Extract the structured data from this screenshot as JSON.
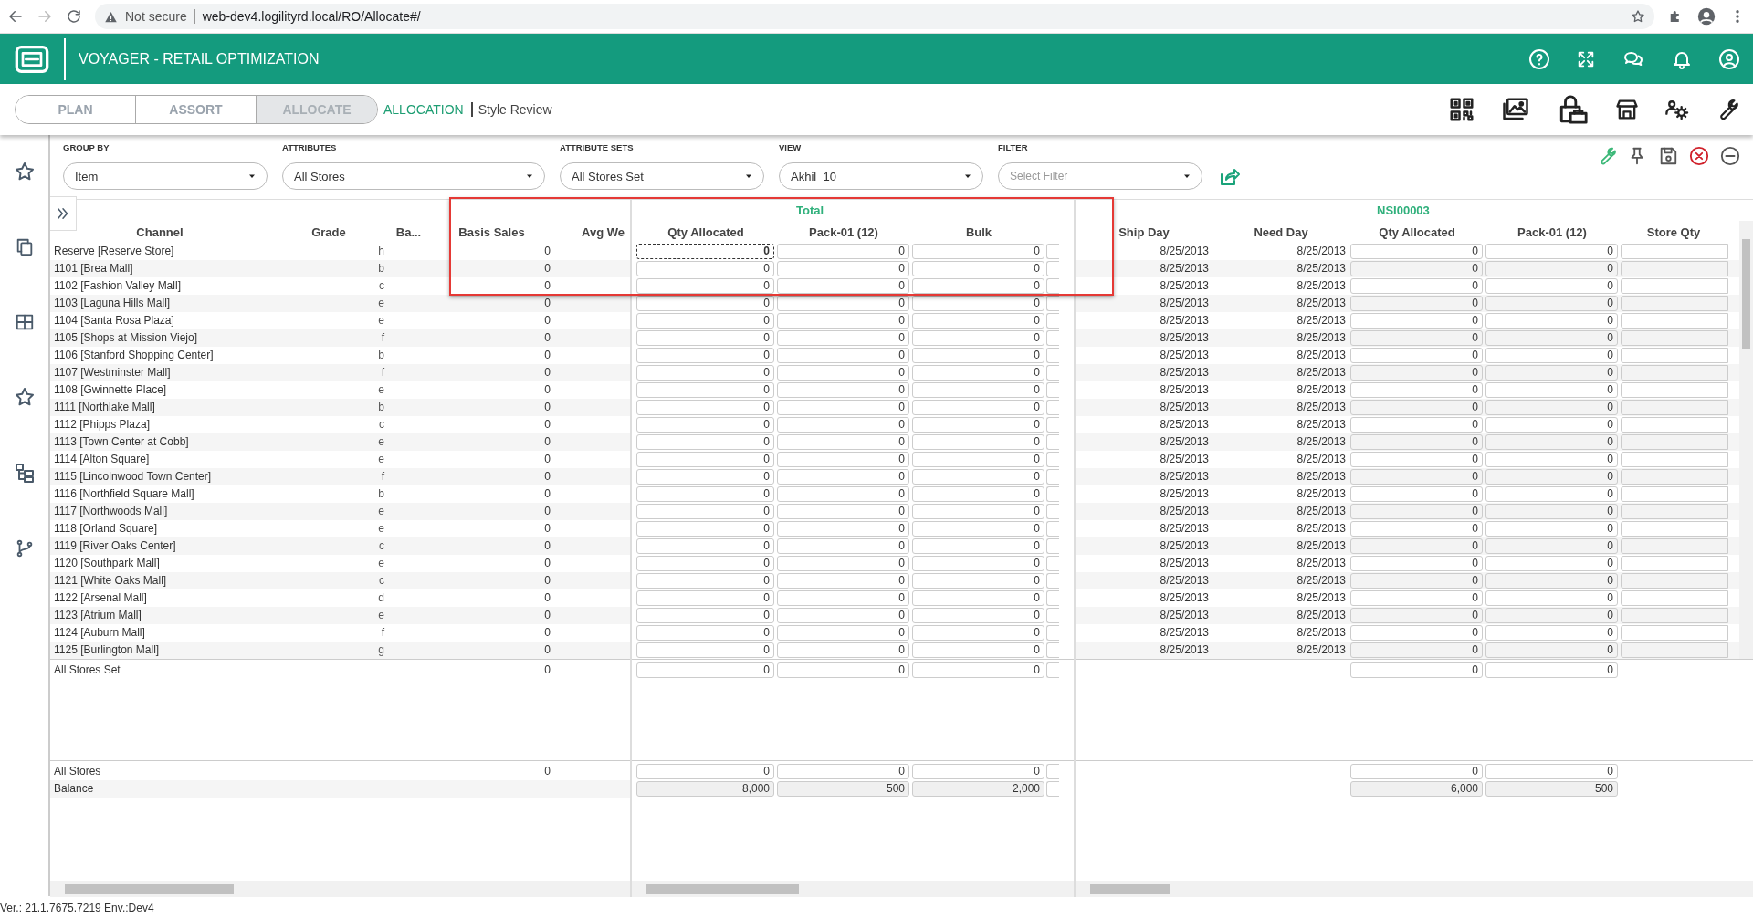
{
  "browser": {
    "security": "Not secure",
    "url": "web-dev4.logilityrd.local/RO/Allocate#/"
  },
  "app": {
    "title": "VOYAGER - RETAIL OPTIMIZATION"
  },
  "modules": [
    {
      "label": "PLAN",
      "selected": false
    },
    {
      "label": "ASSORT",
      "selected": false
    },
    {
      "label": "ALLOCATE",
      "selected": true
    }
  ],
  "breadcrumb": [
    {
      "label": "ALLOCATION",
      "kind": "link"
    },
    {
      "label": "Style Review",
      "kind": "current"
    }
  ],
  "filters": [
    {
      "label": "GROUP BY",
      "value": "Item"
    },
    {
      "label": "ATTRIBUTES",
      "value": "All Stores"
    },
    {
      "label": "ATTRIBUTE SETS",
      "value": "All Stores Set"
    },
    {
      "label": "VIEW",
      "value": "Akhil_10"
    },
    {
      "label": "FILTER",
      "placeholder": "Select Filter"
    }
  ],
  "grid": {
    "total_header": "Total",
    "nsi_header": "NSI00003",
    "left_columns": [
      "Channel",
      "Grade",
      "Ba...",
      "Basis Sales",
      "Avg We"
    ],
    "total_columns": [
      "Qty Allocated",
      "Pack-01 (12)",
      "Bulk"
    ],
    "right_columns": [
      "Ship Day",
      "Need Day",
      "Qty Allocated",
      "Pack-01 (12)",
      "Store Qty"
    ],
    "rows": [
      {
        "channel": "Reserve [Reserve Store]",
        "grade": "h",
        "basis_sales": "0",
        "total": [
          "0",
          "0",
          "0"
        ],
        "ship_day": "8/25/2013",
        "need_day": "8/25/2013",
        "nsi": [
          "0",
          "0"
        ],
        "focused": true
      },
      {
        "channel": "1101 [Brea Mall]",
        "grade": "b",
        "basis_sales": "0",
        "total": [
          "0",
          "0",
          "0"
        ],
        "ship_day": "8/25/2013",
        "need_day": "8/25/2013",
        "nsi": [
          "0",
          "0"
        ],
        "focused": false
      },
      {
        "channel": "1102 [Fashion Valley Mall]",
        "grade": "c",
        "basis_sales": "0",
        "total": [
          "0",
          "0",
          "0"
        ],
        "ship_day": "8/25/2013",
        "need_day": "8/25/2013",
        "nsi": [
          "0",
          "0"
        ],
        "focused": false
      },
      {
        "channel": "1103 [Laguna Hills Mall]",
        "grade": "e",
        "basis_sales": "0",
        "total": [
          "0",
          "0",
          "0"
        ],
        "ship_day": "8/25/2013",
        "need_day": "8/25/2013",
        "nsi": [
          "0",
          "0"
        ],
        "focused": false
      },
      {
        "channel": "1104 [Santa Rosa Plaza]",
        "grade": "e",
        "basis_sales": "0",
        "total": [
          "0",
          "0",
          "0"
        ],
        "ship_day": "8/25/2013",
        "need_day": "8/25/2013",
        "nsi": [
          "0",
          "0"
        ],
        "focused": false
      },
      {
        "channel": "1105 [Shops at Mission Viejo]",
        "grade": "f",
        "basis_sales": "0",
        "total": [
          "0",
          "0",
          "0"
        ],
        "ship_day": "8/25/2013",
        "need_day": "8/25/2013",
        "nsi": [
          "0",
          "0"
        ],
        "focused": false
      },
      {
        "channel": "1106 [Stanford Shopping Center]",
        "grade": "b",
        "basis_sales": "0",
        "total": [
          "0",
          "0",
          "0"
        ],
        "ship_day": "8/25/2013",
        "need_day": "8/25/2013",
        "nsi": [
          "0",
          "0"
        ],
        "focused": false
      },
      {
        "channel": "1107 [Westminster Mall]",
        "grade": "f",
        "basis_sales": "0",
        "total": [
          "0",
          "0",
          "0"
        ],
        "ship_day": "8/25/2013",
        "need_day": "8/25/2013",
        "nsi": [
          "0",
          "0"
        ],
        "focused": false
      },
      {
        "channel": "1108 [Gwinnette Place]",
        "grade": "e",
        "basis_sales": "0",
        "total": [
          "0",
          "0",
          "0"
        ],
        "ship_day": "8/25/2013",
        "need_day": "8/25/2013",
        "nsi": [
          "0",
          "0"
        ],
        "focused": false
      },
      {
        "channel": "1111 [Northlake Mall]",
        "grade": "b",
        "basis_sales": "0",
        "total": [
          "0",
          "0",
          "0"
        ],
        "ship_day": "8/25/2013",
        "need_day": "8/25/2013",
        "nsi": [
          "0",
          "0"
        ],
        "focused": false
      },
      {
        "channel": "1112 [Phipps Plaza]",
        "grade": "c",
        "basis_sales": "0",
        "total": [
          "0",
          "0",
          "0"
        ],
        "ship_day": "8/25/2013",
        "need_day": "8/25/2013",
        "nsi": [
          "0",
          "0"
        ],
        "focused": false
      },
      {
        "channel": "1113 [Town Center at Cobb]",
        "grade": "e",
        "basis_sales": "0",
        "total": [
          "0",
          "0",
          "0"
        ],
        "ship_day": "8/25/2013",
        "need_day": "8/25/2013",
        "nsi": [
          "0",
          "0"
        ],
        "focused": false
      },
      {
        "channel": "1114 [Alton Square]",
        "grade": "e",
        "basis_sales": "0",
        "total": [
          "0",
          "0",
          "0"
        ],
        "ship_day": "8/25/2013",
        "need_day": "8/25/2013",
        "nsi": [
          "0",
          "0"
        ],
        "focused": false
      },
      {
        "channel": "1115 [Lincolnwood Town Center]",
        "grade": "f",
        "basis_sales": "0",
        "total": [
          "0",
          "0",
          "0"
        ],
        "ship_day": "8/25/2013",
        "need_day": "8/25/2013",
        "nsi": [
          "0",
          "0"
        ],
        "focused": false
      },
      {
        "channel": "1116 [Northfield Square Mall]",
        "grade": "b",
        "basis_sales": "0",
        "total": [
          "0",
          "0",
          "0"
        ],
        "ship_day": "8/25/2013",
        "need_day": "8/25/2013",
        "nsi": [
          "0",
          "0"
        ],
        "focused": false
      },
      {
        "channel": "1117 [Northwoods Mall]",
        "grade": "e",
        "basis_sales": "0",
        "total": [
          "0",
          "0",
          "0"
        ],
        "ship_day": "8/25/2013",
        "need_day": "8/25/2013",
        "nsi": [
          "0",
          "0"
        ],
        "focused": false
      },
      {
        "channel": "1118 [Orland Square]",
        "grade": "e",
        "basis_sales": "0",
        "total": [
          "0",
          "0",
          "0"
        ],
        "ship_day": "8/25/2013",
        "need_day": "8/25/2013",
        "nsi": [
          "0",
          "0"
        ],
        "focused": false
      },
      {
        "channel": "1119 [River Oaks Center]",
        "grade": "c",
        "basis_sales": "0",
        "total": [
          "0",
          "0",
          "0"
        ],
        "ship_day": "8/25/2013",
        "need_day": "8/25/2013",
        "nsi": [
          "0",
          "0"
        ],
        "focused": false
      },
      {
        "channel": "1120 [Southpark Mall]",
        "grade": "e",
        "basis_sales": "0",
        "total": [
          "0",
          "0",
          "0"
        ],
        "ship_day": "8/25/2013",
        "need_day": "8/25/2013",
        "nsi": [
          "0",
          "0"
        ],
        "focused": false
      },
      {
        "channel": "1121 [White Oaks Mall]",
        "grade": "c",
        "basis_sales": "0",
        "total": [
          "0",
          "0",
          "0"
        ],
        "ship_day": "8/25/2013",
        "need_day": "8/25/2013",
        "nsi": [
          "0",
          "0"
        ],
        "focused": false
      },
      {
        "channel": "1122 [Arsenal Mall]",
        "grade": "d",
        "basis_sales": "0",
        "total": [
          "0",
          "0",
          "0"
        ],
        "ship_day": "8/25/2013",
        "need_day": "8/25/2013",
        "nsi": [
          "0",
          "0"
        ],
        "focused": false
      },
      {
        "channel": "1123 [Atrium Mall]",
        "grade": "e",
        "basis_sales": "0",
        "total": [
          "0",
          "0",
          "0"
        ],
        "ship_day": "8/25/2013",
        "need_day": "8/25/2013",
        "nsi": [
          "0",
          "0"
        ],
        "focused": false
      },
      {
        "channel": "1124 [Auburn Mall]",
        "grade": "f",
        "basis_sales": "0",
        "total": [
          "0",
          "0",
          "0"
        ],
        "ship_day": "8/25/2013",
        "need_day": "8/25/2013",
        "nsi": [
          "0",
          "0"
        ],
        "focused": false
      },
      {
        "channel": "1125 [Burlington Mall]",
        "grade": "g",
        "basis_sales": "0",
        "total": [
          "0",
          "0",
          "0"
        ],
        "ship_day": "8/25/2013",
        "need_day": "8/25/2013",
        "nsi": [
          "0",
          "0"
        ],
        "focused": false
      }
    ],
    "set_rows": [
      {
        "label": "All Stores Set",
        "kind": "editable",
        "basis_sales": "0",
        "total": [
          "0",
          "0",
          "0"
        ],
        "nsi": [
          "0",
          "0"
        ]
      }
    ],
    "summary_rows": [
      {
        "label": "All Stores",
        "kind": "editable",
        "basis_sales": "0",
        "total": [
          "0",
          "0",
          "0"
        ],
        "nsi": [
          "0",
          "0"
        ]
      },
      {
        "label": "Balance",
        "kind": "readonly",
        "total": [
          "8,000",
          "500",
          "2,000"
        ],
        "nsi": [
          "6,000",
          "500"
        ]
      }
    ]
  },
  "footer": "Ver.: 21.1.7675.7219 Env.:Dev4"
}
